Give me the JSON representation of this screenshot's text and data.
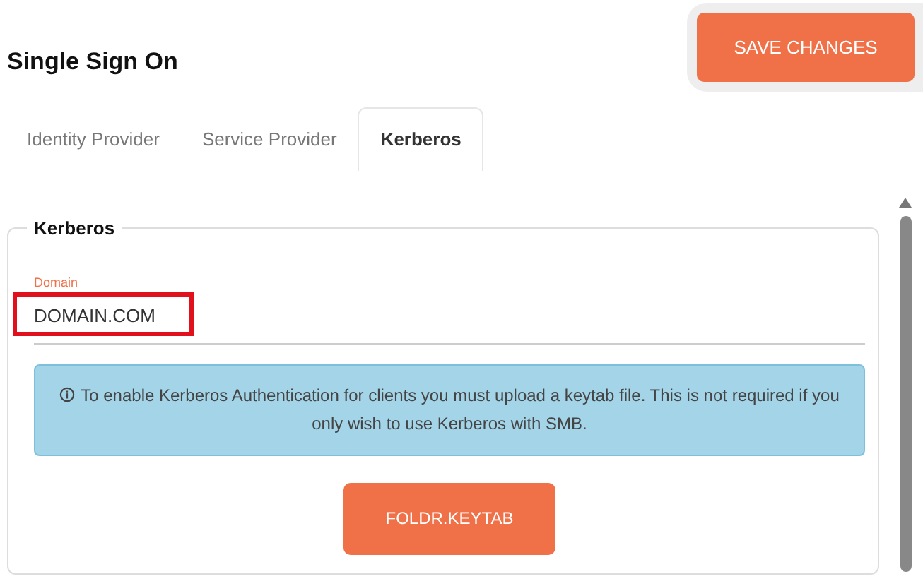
{
  "page": {
    "title": "Single Sign On"
  },
  "save_button": {
    "label": "SAVE CHANGES"
  },
  "tabs": [
    {
      "label": "Identity Provider",
      "selected": false
    },
    {
      "label": "Service Provider",
      "selected": false
    },
    {
      "label": "Kerberos",
      "selected": true
    }
  ],
  "section": {
    "title": "Kerberos",
    "domain_field": {
      "label": "Domain",
      "value": "DOMAIN.COM",
      "highlighted": true
    },
    "info": {
      "text": "To enable Kerberos Authentication for clients you must upload a keytab file. This is not required if you only wish to use Kerberos with SMB."
    },
    "upload_button": {
      "label": "FOLDR.KEYTAB"
    }
  }
}
